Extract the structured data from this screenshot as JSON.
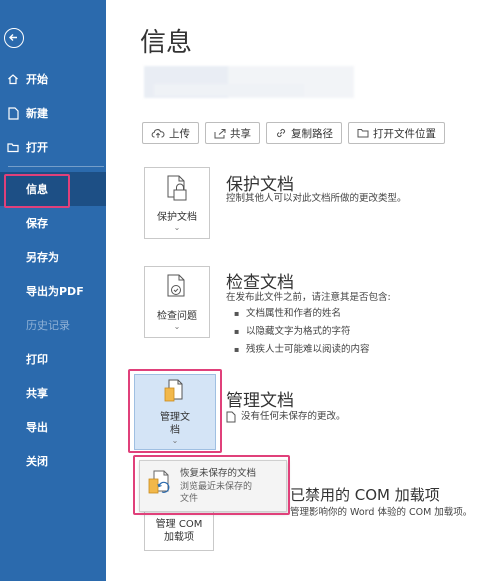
{
  "sidebar": {
    "top_items": [
      {
        "label": "开始",
        "icon": "home-icon"
      },
      {
        "label": "新建",
        "icon": "new-document-icon"
      },
      {
        "label": "打开",
        "icon": "folder-open-icon"
      }
    ],
    "bottom_items": [
      {
        "label": "信息",
        "state": "active"
      },
      {
        "label": "保存"
      },
      {
        "label": "另存为"
      },
      {
        "label": "导出为PDF"
      },
      {
        "label": "历史记录",
        "state": "disabled"
      },
      {
        "label": "打印"
      },
      {
        "label": "共享"
      },
      {
        "label": "导出"
      },
      {
        "label": "关闭"
      }
    ]
  },
  "main": {
    "title": "信息",
    "toolbar": {
      "upload": "上传",
      "share": "共享",
      "copy_path": "复制路径",
      "open_location": "打开文件位置"
    },
    "protect": {
      "card_label": "保护文档",
      "title": "保护文档",
      "desc": "控制其他人可以对此文档所做的更改类型。"
    },
    "inspect": {
      "card_label": "检查问题",
      "title": "检查文档",
      "desc": "在发布此文件之前，请注意其是否包含:",
      "bullets": [
        "文档属性和作者的姓名",
        "以隐藏文字为格式的字符",
        "残疾人士可能难以阅读的内容"
      ]
    },
    "manage": {
      "card_label_line1": "管理文",
      "card_label_line2": "档",
      "title": "管理文档",
      "desc": "没有任何未保存的更改。"
    },
    "popup": {
      "title": "恢复未保存的文档",
      "desc_line1": "浏览最近未保存的",
      "desc_line2": "文件"
    },
    "com": {
      "card_label_line1": "管理 COM",
      "card_label_line2": "加载项",
      "title_visible": "已禁用的 COM 加载项",
      "desc_visible": "管理影响你的 Word 体验的 COM 加载项。"
    }
  },
  "colors": {
    "sidebar_bg": "#2b6aad",
    "sidebar_active": "#1d4f85",
    "highlight_box": "#e0407a",
    "manage_card_bg": "#d4e4f6"
  }
}
